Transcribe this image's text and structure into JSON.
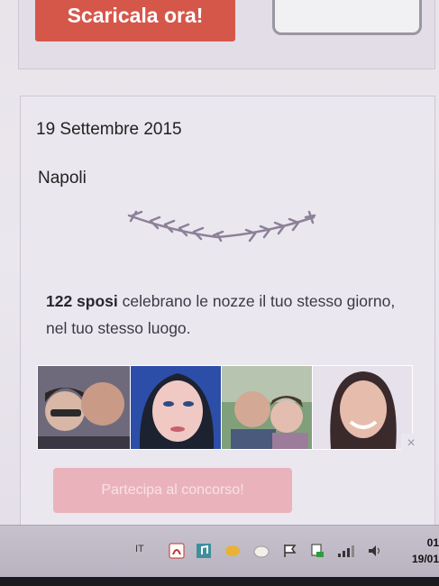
{
  "top_banner": {
    "download_label": "Scaricala ora!"
  },
  "wedding": {
    "date": "19 Settembre 2015",
    "city": "Napoli",
    "count": "122 sposi",
    "description_rest": " celebrano le nozze il tuo stesso giorno, nel tuo stesso luogo."
  },
  "photos": [
    {
      "name": "couple-1"
    },
    {
      "name": "woman-1"
    },
    {
      "name": "couple-2"
    },
    {
      "name": "woman-2"
    }
  ],
  "close_label": "×",
  "cta_label": "Partecipa al concorso!",
  "taskbar": {
    "language": "IT",
    "time": "01",
    "date": "19/01",
    "icons": [
      "acrobat-icon",
      "music-icon",
      "shield-icon",
      "cloud-icon",
      "flag-icon",
      "network-icon",
      "signal-icon",
      "volume-icon"
    ]
  },
  "colors": {
    "accent": "#d5574a",
    "cta_disabled": "#eab3bb",
    "laurel": "#8c8199"
  }
}
